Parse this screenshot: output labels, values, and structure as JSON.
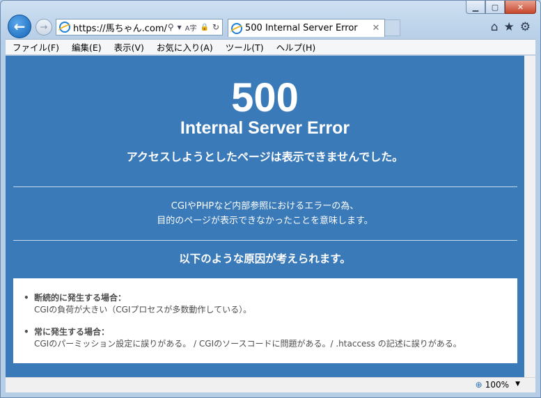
{
  "browser": {
    "url": "https://馬ちゃん.com/",
    "tab_title": "500 Internal Server Error",
    "zoom": "100%",
    "caption": {
      "minimize": "▁",
      "maximize": "▢",
      "close": "✕"
    },
    "nav_icons": {
      "back": "←",
      "forward": "→"
    },
    "addr_icons": {
      "search": "⚲",
      "dropdown": "▾",
      "compat": "A字",
      "lock": "🔒",
      "refresh": "↻"
    },
    "right_icons": {
      "home": "⌂",
      "favorites": "★",
      "settings": "⚙"
    },
    "tab_close": "✕",
    "zoom_icon": "⊕",
    "zoom_dropdown": "▼"
  },
  "menu": [
    "ファイル(F)",
    "編集(E)",
    "表示(V)",
    "お気に入り(A)",
    "ツール(T)",
    "ヘルプ(H)"
  ],
  "page": {
    "code": "500",
    "title": "Internal Server Error",
    "headline": "アクセスしようとしたページは表示できませんでした。",
    "explain_line1": "CGIやPHPなど内部参照におけるエラーの為、",
    "explain_line2": "目的のページが表示できなかったことを意味します。",
    "causes_heading": "以下のような原因が考えられます。",
    "causes": [
      {
        "title": "断続的に発生する場合：",
        "desc": "CGIの負荷が大きい（CGIプロセスが多数動作している）。"
      },
      {
        "title": "常に発生する場合：",
        "desc": "CGIのパーミッション設定に誤りがある。 / CGIのソースコードに問題がある。/ .htaccess の記述に誤りがある。"
      }
    ]
  }
}
